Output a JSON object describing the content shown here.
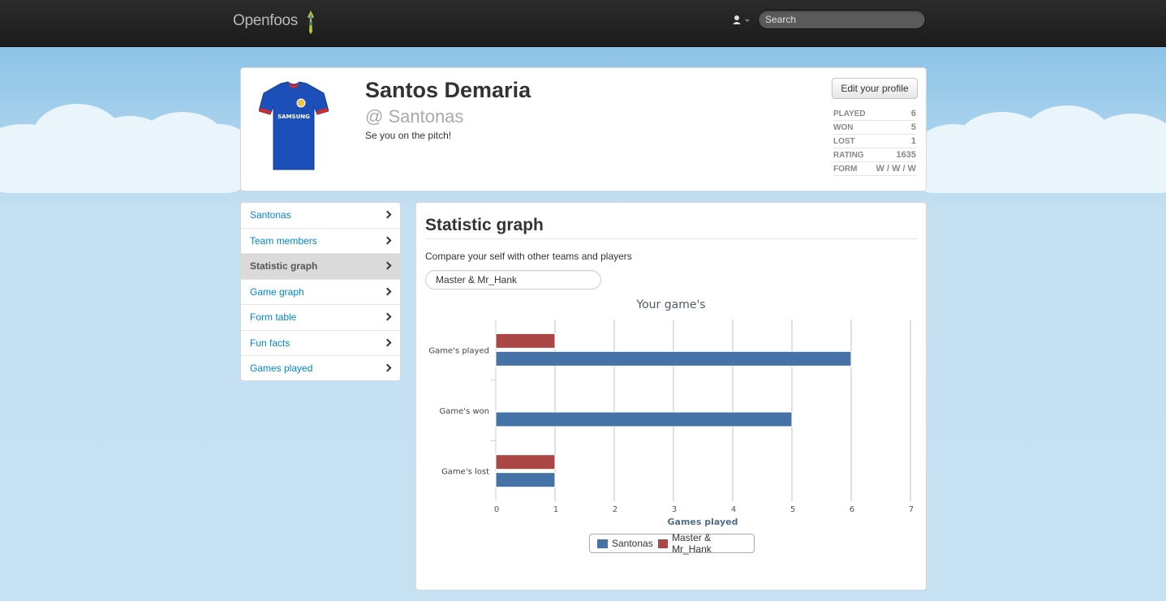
{
  "navbar": {
    "brand": "Openfoos",
    "search_placeholder": "Search"
  },
  "profile": {
    "name": "Santos Demaria",
    "handle": "@ Santonas",
    "bio": "Se you on the pitch!",
    "edit_button": "Edit your profile",
    "stats": [
      {
        "label": "PLAYED",
        "value": "6"
      },
      {
        "label": "WON",
        "value": "5"
      },
      {
        "label": "LOST",
        "value": "1"
      },
      {
        "label": "RATING",
        "value": "1635"
      },
      {
        "label": "FORM",
        "value": "W / W / W"
      }
    ],
    "jersey_sponsor": "SAMSUNG"
  },
  "sidebar": {
    "items": [
      {
        "label": "Santonas"
      },
      {
        "label": "Team members"
      },
      {
        "label": "Statistic graph"
      },
      {
        "label": "Game graph"
      },
      {
        "label": "Form table"
      },
      {
        "label": "Fun facts"
      },
      {
        "label": "Games played"
      }
    ],
    "active_index": 2
  },
  "main": {
    "title": "Statistic graph",
    "subtitle": "Compare your self with other teams and players",
    "compare_value": "Master & Mr_Hank"
  },
  "chart_data": {
    "type": "bar",
    "orientation": "horizontal",
    "title": "Your game's",
    "xlabel": "Games played",
    "ylabel": "",
    "categories": [
      "Game's played",
      "Game's won",
      "Game's lost"
    ],
    "xlim": [
      0,
      7
    ],
    "x_ticks": [
      "0",
      "1",
      "2",
      "3",
      "4",
      "5",
      "6",
      "7"
    ],
    "grid": true,
    "legend_position": "bottom",
    "series": [
      {
        "name": "Santonas",
        "color": "#4572a7",
        "values": [
          6,
          5,
          1
        ]
      },
      {
        "name": "Master & Mr_Hank",
        "color": "#aa4643",
        "values": [
          1,
          0,
          1
        ]
      }
    ]
  }
}
